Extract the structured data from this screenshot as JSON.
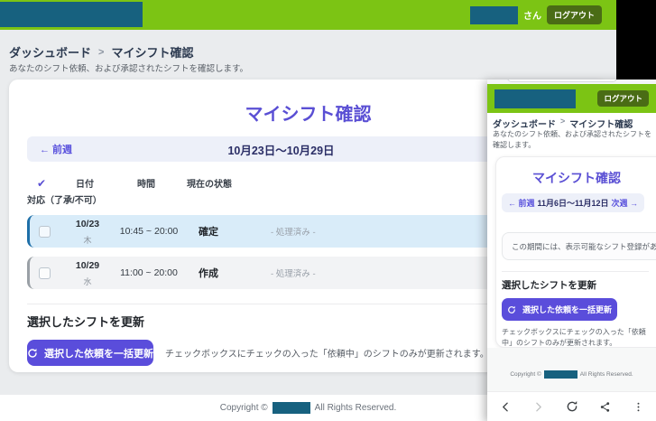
{
  "colors": {
    "brand_green": "#7cc414",
    "logout_dark_green": "#4a6c15",
    "accent_purple_button": "#5a4ddb",
    "title_purple": "#5a4fd4",
    "week_navy": "#2b2e66",
    "redaction_teal": "#17617f",
    "row_selected_bg": "#d9ecf9",
    "row_selected_border": "#1e6fa8",
    "row_default_bg": "#f2f3f5",
    "row_default_border": "#9aa0a6"
  },
  "desktop": {
    "header": {
      "user_suffix": "さん",
      "logout_label": "ログアウト"
    },
    "breadcrumb": {
      "home": "ダッシュボード",
      "separator": ">",
      "current": "マイシフト確認"
    },
    "subtitle": "あなたのシフト依頼、および承認されたシフトを確認します。",
    "card": {
      "title": "マイシフト確認",
      "week_nav": {
        "prev": "← 前週",
        "range": "10月23日〜10月29日"
      },
      "table": {
        "check_icon": "✔",
        "check_header": "対応（了承/不可）",
        "col_date": "日付",
        "col_time": "時間",
        "col_status": "現在の状態",
        "rows": [
          {
            "date": "10/23",
            "day": "木",
            "time": "10:45 ~ 20:00",
            "status": "確定",
            "action": "- 処理済み -"
          },
          {
            "date": "10/29",
            "day": "水",
            "time": "11:00 ~ 20:00",
            "status": "作成",
            "action": "- 処理済み -"
          }
        ]
      },
      "update": {
        "heading": "選択したシフトを更新",
        "button_label": "選択した依頼を一括更新",
        "note": "チェックボックスにチェックの入った「依頼中」のシフトのみが更新されます。"
      }
    },
    "footer": {
      "prefix": "Copyright ©",
      "suffix": "All Rights Reserved."
    }
  },
  "mobile": {
    "header": {
      "logout_label": "ログアウト"
    },
    "breadcrumb": {
      "home": "ダッシュボード",
      "separator": ">",
      "current": "マイシフト確認"
    },
    "subtitle": "あなたのシフト依頼、および承認されたシフトを確認します。",
    "card": {
      "title": "マイシフト確認",
      "week_nav": {
        "prev": "← 前週",
        "range": "11月6日〜11月12日",
        "next": "次週 →"
      },
      "empty_message": "この期間には、表示可能なシフト登録があ",
      "update": {
        "heading": "選択したシフトを更新",
        "button_label": "選択した依頼を一括更新",
        "note": "チェックボックスにチェックの入った「依頼中」のシフトのみが更新されます。"
      }
    },
    "footer": {
      "prefix": "Copyright ©",
      "suffix": "All Rights Reserved."
    }
  }
}
